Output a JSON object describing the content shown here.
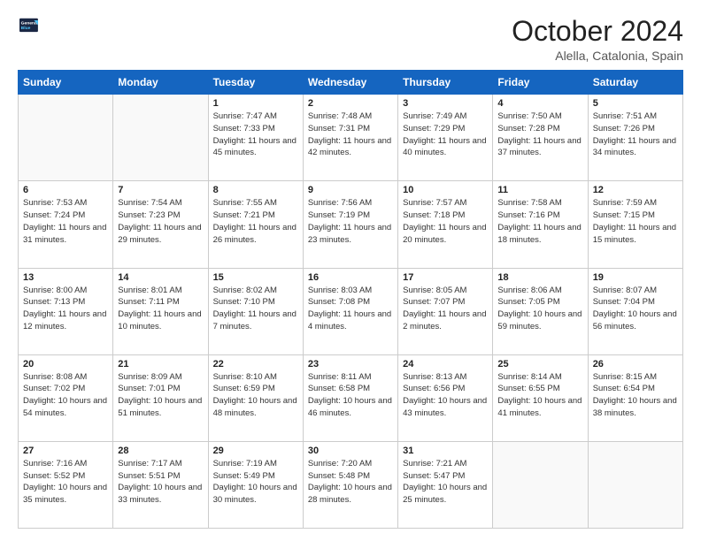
{
  "logo": {
    "line1": "General",
    "line2": "Blue"
  },
  "title": "October 2024",
  "location": "Alella, Catalonia, Spain",
  "days_header": [
    "Sunday",
    "Monday",
    "Tuesday",
    "Wednesday",
    "Thursday",
    "Friday",
    "Saturday"
  ],
  "weeks": [
    [
      {
        "day": "",
        "info": ""
      },
      {
        "day": "",
        "info": ""
      },
      {
        "day": "1",
        "info": "Sunrise: 7:47 AM\nSunset: 7:33 PM\nDaylight: 11 hours and 45 minutes."
      },
      {
        "day": "2",
        "info": "Sunrise: 7:48 AM\nSunset: 7:31 PM\nDaylight: 11 hours and 42 minutes."
      },
      {
        "day": "3",
        "info": "Sunrise: 7:49 AM\nSunset: 7:29 PM\nDaylight: 11 hours and 40 minutes."
      },
      {
        "day": "4",
        "info": "Sunrise: 7:50 AM\nSunset: 7:28 PM\nDaylight: 11 hours and 37 minutes."
      },
      {
        "day": "5",
        "info": "Sunrise: 7:51 AM\nSunset: 7:26 PM\nDaylight: 11 hours and 34 minutes."
      }
    ],
    [
      {
        "day": "6",
        "info": "Sunrise: 7:53 AM\nSunset: 7:24 PM\nDaylight: 11 hours and 31 minutes."
      },
      {
        "day": "7",
        "info": "Sunrise: 7:54 AM\nSunset: 7:23 PM\nDaylight: 11 hours and 29 minutes."
      },
      {
        "day": "8",
        "info": "Sunrise: 7:55 AM\nSunset: 7:21 PM\nDaylight: 11 hours and 26 minutes."
      },
      {
        "day": "9",
        "info": "Sunrise: 7:56 AM\nSunset: 7:19 PM\nDaylight: 11 hours and 23 minutes."
      },
      {
        "day": "10",
        "info": "Sunrise: 7:57 AM\nSunset: 7:18 PM\nDaylight: 11 hours and 20 minutes."
      },
      {
        "day": "11",
        "info": "Sunrise: 7:58 AM\nSunset: 7:16 PM\nDaylight: 11 hours and 18 minutes."
      },
      {
        "day": "12",
        "info": "Sunrise: 7:59 AM\nSunset: 7:15 PM\nDaylight: 11 hours and 15 minutes."
      }
    ],
    [
      {
        "day": "13",
        "info": "Sunrise: 8:00 AM\nSunset: 7:13 PM\nDaylight: 11 hours and 12 minutes."
      },
      {
        "day": "14",
        "info": "Sunrise: 8:01 AM\nSunset: 7:11 PM\nDaylight: 11 hours and 10 minutes."
      },
      {
        "day": "15",
        "info": "Sunrise: 8:02 AM\nSunset: 7:10 PM\nDaylight: 11 hours and 7 minutes."
      },
      {
        "day": "16",
        "info": "Sunrise: 8:03 AM\nSunset: 7:08 PM\nDaylight: 11 hours and 4 minutes."
      },
      {
        "day": "17",
        "info": "Sunrise: 8:05 AM\nSunset: 7:07 PM\nDaylight: 11 hours and 2 minutes."
      },
      {
        "day": "18",
        "info": "Sunrise: 8:06 AM\nSunset: 7:05 PM\nDaylight: 10 hours and 59 minutes."
      },
      {
        "day": "19",
        "info": "Sunrise: 8:07 AM\nSunset: 7:04 PM\nDaylight: 10 hours and 56 minutes."
      }
    ],
    [
      {
        "day": "20",
        "info": "Sunrise: 8:08 AM\nSunset: 7:02 PM\nDaylight: 10 hours and 54 minutes."
      },
      {
        "day": "21",
        "info": "Sunrise: 8:09 AM\nSunset: 7:01 PM\nDaylight: 10 hours and 51 minutes."
      },
      {
        "day": "22",
        "info": "Sunrise: 8:10 AM\nSunset: 6:59 PM\nDaylight: 10 hours and 48 minutes."
      },
      {
        "day": "23",
        "info": "Sunrise: 8:11 AM\nSunset: 6:58 PM\nDaylight: 10 hours and 46 minutes."
      },
      {
        "day": "24",
        "info": "Sunrise: 8:13 AM\nSunset: 6:56 PM\nDaylight: 10 hours and 43 minutes."
      },
      {
        "day": "25",
        "info": "Sunrise: 8:14 AM\nSunset: 6:55 PM\nDaylight: 10 hours and 41 minutes."
      },
      {
        "day": "26",
        "info": "Sunrise: 8:15 AM\nSunset: 6:54 PM\nDaylight: 10 hours and 38 minutes."
      }
    ],
    [
      {
        "day": "27",
        "info": "Sunrise: 7:16 AM\nSunset: 5:52 PM\nDaylight: 10 hours and 35 minutes."
      },
      {
        "day": "28",
        "info": "Sunrise: 7:17 AM\nSunset: 5:51 PM\nDaylight: 10 hours and 33 minutes."
      },
      {
        "day": "29",
        "info": "Sunrise: 7:19 AM\nSunset: 5:49 PM\nDaylight: 10 hours and 30 minutes."
      },
      {
        "day": "30",
        "info": "Sunrise: 7:20 AM\nSunset: 5:48 PM\nDaylight: 10 hours and 28 minutes."
      },
      {
        "day": "31",
        "info": "Sunrise: 7:21 AM\nSunset: 5:47 PM\nDaylight: 10 hours and 25 minutes."
      },
      {
        "day": "",
        "info": ""
      },
      {
        "day": "",
        "info": ""
      }
    ]
  ]
}
